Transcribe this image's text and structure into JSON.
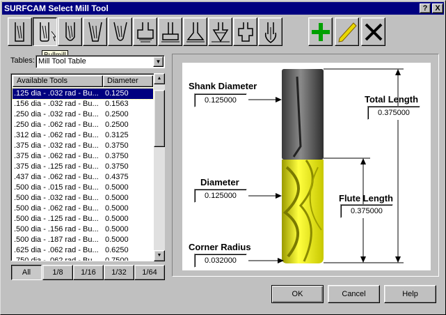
{
  "window": {
    "title": "SURFCAM Select Mill Tool"
  },
  "titlebar_buttons": {
    "help": "?",
    "close": "X"
  },
  "toolbar": {
    "tools": [
      {
        "icon": "flatmill-icon"
      },
      {
        "icon": "bullmill-icon"
      },
      {
        "icon": "ballmill-icon"
      },
      {
        "icon": "taper-mill-icon"
      },
      {
        "icon": "taper-ballmill-icon"
      },
      {
        "icon": "slot-cutter-icon"
      },
      {
        "icon": "face-mill-icon"
      },
      {
        "icon": "dovetail-icon"
      },
      {
        "icon": "thread-mill-icon"
      },
      {
        "icon": "counterbore-icon"
      },
      {
        "icon": "drill-icon"
      }
    ],
    "actions": [
      {
        "icon": "add-icon",
        "color": "#00a000"
      },
      {
        "icon": "edit-pencil-icon",
        "color": "#e8d800"
      },
      {
        "icon": "delete-icon",
        "color": "#000000"
      }
    ],
    "tooltip": "Bullmill"
  },
  "tables": {
    "label": "Tables:",
    "value": "Mill Tool Table"
  },
  "tool_list": {
    "headers": [
      "Available Tools",
      "Diameter"
    ],
    "rows": [
      {
        "name": ".125 dia - .032 rad - Bu...",
        "diameter": "0.1250"
      },
      {
        "name": ".156 dia - .032 rad - Bu...",
        "diameter": "0.1563"
      },
      {
        "name": ".250 dia - .032 rad - Bu...",
        "diameter": "0.2500"
      },
      {
        "name": ".250 dia - .062 rad - Bu...",
        "diameter": "0.2500"
      },
      {
        "name": ".312 dia - .062 rad - Bu...",
        "diameter": "0.3125"
      },
      {
        "name": ".375 dia - .032 rad - Bu...",
        "diameter": "0.3750"
      },
      {
        "name": ".375 dia - .062 rad - Bu...",
        "diameter": "0.3750"
      },
      {
        "name": ".375 dia - .125 rad - Bu...",
        "diameter": "0.3750"
      },
      {
        "name": ".437 dia - .062 rad - Bu...",
        "diameter": "0.4375"
      },
      {
        "name": ".500 dia - .015 rad - Bu...",
        "diameter": "0.5000"
      },
      {
        "name": ".500 dia - .032 rad - Bu...",
        "diameter": "0.5000"
      },
      {
        "name": ".500 dia - .062 rad - Bu...",
        "diameter": "0.5000"
      },
      {
        "name": ".500 dia - .125 rad - Bu...",
        "diameter": "0.5000"
      },
      {
        "name": ".500 dia - .156 rad - Bu...",
        "diameter": "0.5000"
      },
      {
        "name": ".500 dia - .187 rad - Bu...",
        "diameter": "0.5000"
      },
      {
        "name": ".625 dia - .062 rad - Bu...",
        "diameter": "0.6250"
      },
      {
        "name": ".750 dia - .062 rad - Bu...",
        "diameter": "0.7500"
      }
    ],
    "selected_index": 0
  },
  "filters": [
    "All",
    "1/8",
    "1/16",
    "1/32",
    "1/64"
  ],
  "diagram": {
    "shank_diameter_label": "Shank Diameter",
    "shank_diameter_value": "0.125000",
    "diameter_label": "Diameter",
    "diameter_value": "0.125000",
    "corner_radius_label": "Corner Radius",
    "corner_radius_value": "0.032000",
    "total_length_label": "Total Length",
    "total_length_value": "0.375000",
    "flute_length_label": "Flute Length",
    "flute_length_value": "0.375000",
    "colors": {
      "shank": "#5a5a5a",
      "flutes": "#e8e800"
    }
  },
  "buttons": {
    "ok": "OK",
    "cancel": "Cancel",
    "help": "Help"
  }
}
